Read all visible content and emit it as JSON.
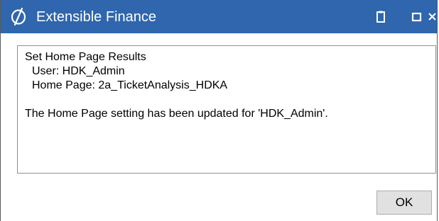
{
  "window": {
    "title": "Extensible Finance",
    "logo_icon": "oracle-sigma-logo",
    "title_color": "#2f66ad",
    "controls": [
      "clipboard-icon",
      "maximize-icon",
      "close-icon"
    ]
  },
  "results": {
    "heading": "Set Home Page Results",
    "user_line": "User: HDK_Admin",
    "home_page_line": "Home Page: 2a_TicketAnalysis_HDKA",
    "message": "The Home Page setting has been updated for 'HDK_Admin'."
  },
  "actions": {
    "ok_label": "OK"
  }
}
